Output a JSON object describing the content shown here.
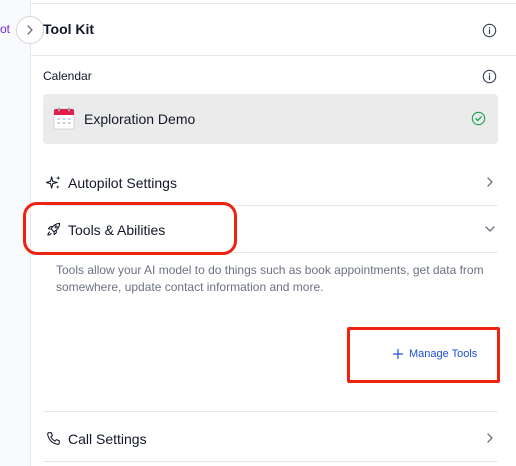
{
  "left_strip": {
    "label": "ot"
  },
  "header": {
    "title": "Tool Kit"
  },
  "calendar": {
    "section_label": "Calendar",
    "selected": "Exploration Demo",
    "status": "connected"
  },
  "rows": {
    "autopilot": {
      "label": "Autopilot Settings",
      "icon": "sparkles-icon",
      "state": "collapsed"
    },
    "tools": {
      "label": "Tools & Abilities",
      "icon": "rocket-icon",
      "state": "expanded",
      "description": "Tools allow your AI model to do things such as book appointments, get data from somewhere, update contact information and more.",
      "manage_label": "Manage Tools"
    },
    "call": {
      "label": "Call Settings",
      "icon": "phone-icon",
      "state": "collapsed"
    }
  },
  "colors": {
    "accent": "#1d4ed8",
    "highlight": "#ee2211",
    "success": "#16a34a",
    "card_bg": "#ebebeb"
  }
}
